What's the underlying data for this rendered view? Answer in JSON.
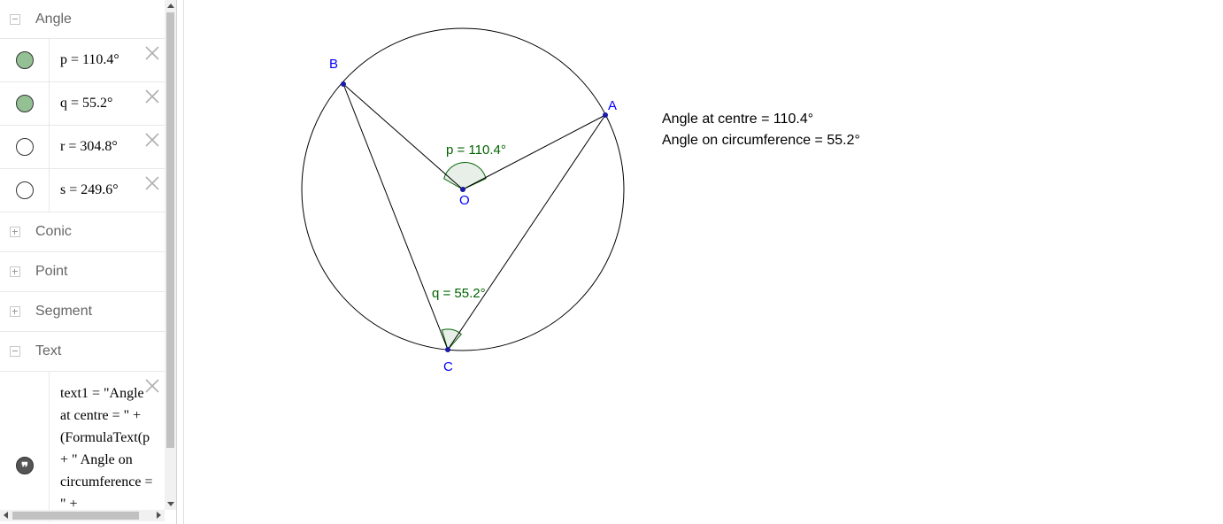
{
  "algebra": {
    "groups": {
      "angle": {
        "label": "Angle",
        "expanded": true
      },
      "conic": {
        "label": "Conic",
        "expanded": false
      },
      "point": {
        "label": "Point",
        "expanded": false
      },
      "segment": {
        "label": "Segment",
        "expanded": false
      },
      "text": {
        "label": "Text",
        "expanded": true
      }
    },
    "angles": [
      {
        "formula": "p = 110.4°",
        "visible": true
      },
      {
        "formula": "q = 55.2°",
        "visible": true
      },
      {
        "formula": "r = 304.8°",
        "visible": false
      },
      {
        "formula": "s = 249.6°",
        "visible": false
      }
    ],
    "text1_lines": [
      "text1 = \"Angle",
      "at centre = \" +",
      "(FormulaText(p",
      "+ \" Angle on",
      "circumference =",
      "\" +"
    ]
  },
  "graphics": {
    "points": {
      "A": "A",
      "B": "B",
      "C": "C",
      "O": "O"
    },
    "angle_labels": {
      "p": "p = 110.4°",
      "q": "q = 55.2°"
    },
    "text": {
      "line1": "Angle at centre = 110.4°",
      "line2": "Angle on circumference = 55.2°"
    }
  },
  "colors": {
    "point": "#1a1aa6",
    "point_label": "#0000ff",
    "angle": "#006400",
    "angle_fill": "#e8efe8",
    "visible_dot": "#93c193",
    "line": "#000000"
  }
}
